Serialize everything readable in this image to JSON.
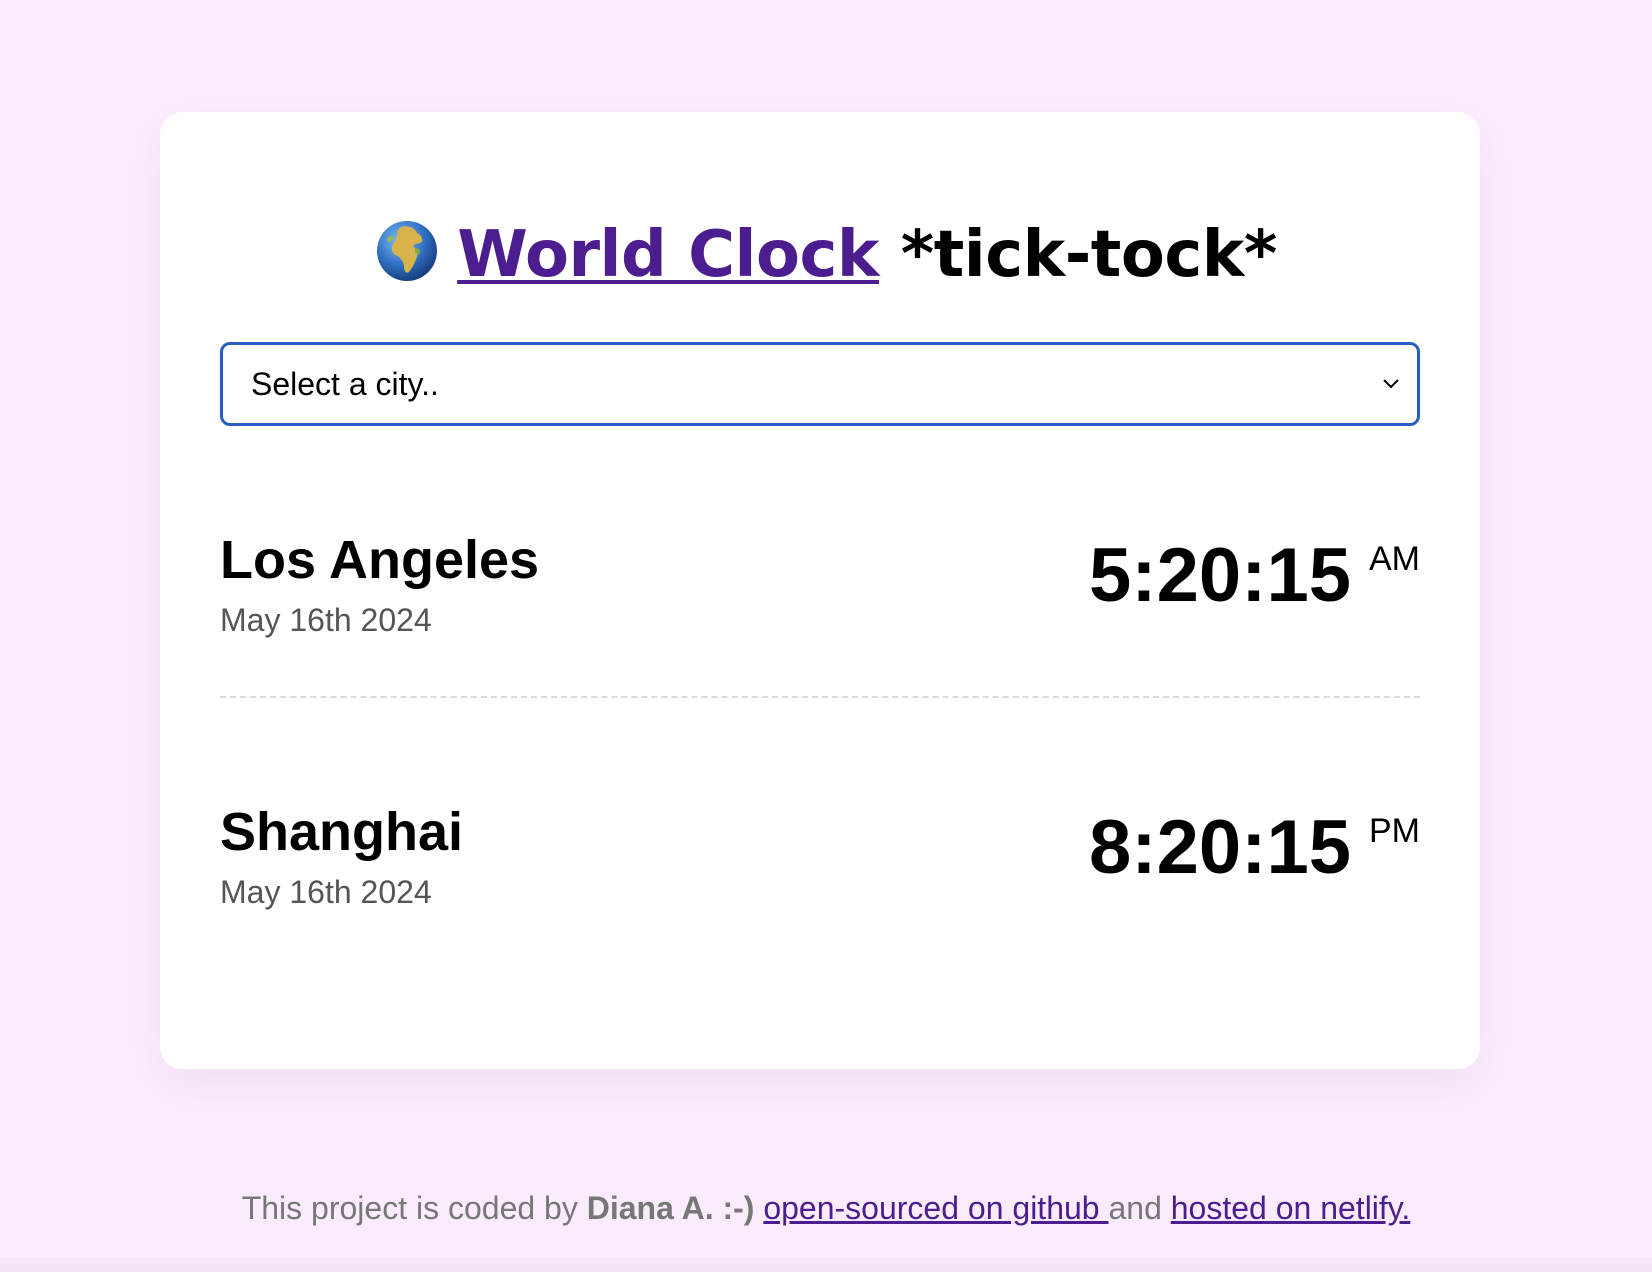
{
  "header": {
    "globe_icon": "globe-africa-icon",
    "link_text": "World Clock",
    "suffix_text": "*tick-tock*"
  },
  "city_select": {
    "selected_value": "Select a city..",
    "icon": "chevron-down-icon"
  },
  "cities": [
    {
      "name": "Los Angeles",
      "date": "May 16th 2024",
      "time": "5:20:15",
      "ampm": "AM"
    },
    {
      "name": "Shanghai",
      "date": "May 16th 2024",
      "time": "8:20:15",
      "ampm": "PM"
    }
  ],
  "footer": {
    "prefix": "This project is coded by ",
    "author": "Diana A. :-)",
    "github_link": "open-sourced on github ",
    "middle": "and ",
    "netlify_link": "hosted on netlify."
  },
  "colors": {
    "background": "#fbecfd",
    "card": "#ffffff",
    "link": "#4c1d8f",
    "select_border": "#2b5ec4"
  }
}
